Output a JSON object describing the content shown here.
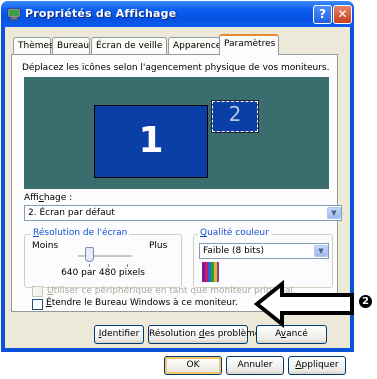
{
  "window": {
    "title": "Propriétés de Affichage",
    "help_glyph": "?",
    "close_glyph": "✕"
  },
  "tabs": [
    {
      "label": "Thèmes",
      "active": false
    },
    {
      "label": "Bureau",
      "active": false
    },
    {
      "label": "Écran de veille",
      "active": false
    },
    {
      "label": "Apparence",
      "active": false
    },
    {
      "label": "Paramètres",
      "active": true
    }
  ],
  "instruction": "Déplacez les icônes selon l'agencement physique de vos moniteurs.",
  "monitors": [
    {
      "number": "1",
      "primary": true
    },
    {
      "number": "2",
      "primary": false
    }
  ],
  "display": {
    "label_prefix": "Affi",
    "label_mnemonic": "c",
    "label_suffix": "hage :",
    "selected": "2. Écran par défaut"
  },
  "resolution": {
    "group_mnemonic": "R",
    "group_rest": "ésolution de l'écran",
    "min_label": "Moins",
    "max_label": "Plus",
    "value_text": "640 par 480 pixels",
    "slider_fraction": 0.15
  },
  "color_quality": {
    "group_mnemonic": "Q",
    "group_rest": "ualité couleur",
    "selected": "Faible (8 bits)"
  },
  "options": {
    "use_primary": {
      "mnemonic": "U",
      "label_rest": "tiliser ce périphérique en tant que moniteur principal.",
      "checked": false,
      "enabled": false
    },
    "extend_desktop": {
      "mnemonic": "É",
      "label_rest": "tendre le Bureau Windows à ce moniteur.",
      "checked": false,
      "enabled": true
    }
  },
  "panel_buttons": {
    "identify": {
      "mnemonic": "I",
      "rest": "dentifier"
    },
    "troubleshoot": {
      "before": "Résolution ",
      "mnemonic": "d",
      "rest": "es problèmes"
    },
    "advanced": {
      "before": "A",
      "mnemonic": "v",
      "rest": "ancé"
    }
  },
  "dialog_buttons": {
    "ok": "OK",
    "cancel": "Annuler",
    "apply": {
      "mnemonic": "A",
      "rest": "ppliquer"
    }
  },
  "annotation": {
    "badge": "❷"
  },
  "colors": {
    "title_bar": "#0a5cf2",
    "dialog_face": "#ece9d8",
    "monitor_background": "#3a6e6e",
    "monitor_blue": "#0a3fa8",
    "active_tab_accent": "#e68b2c",
    "group_label": "#1550d2"
  },
  "icons": {
    "app": "display-properties-icon",
    "arrow": "left-arrow-icon",
    "dropdown": "chevron-down-icon"
  }
}
